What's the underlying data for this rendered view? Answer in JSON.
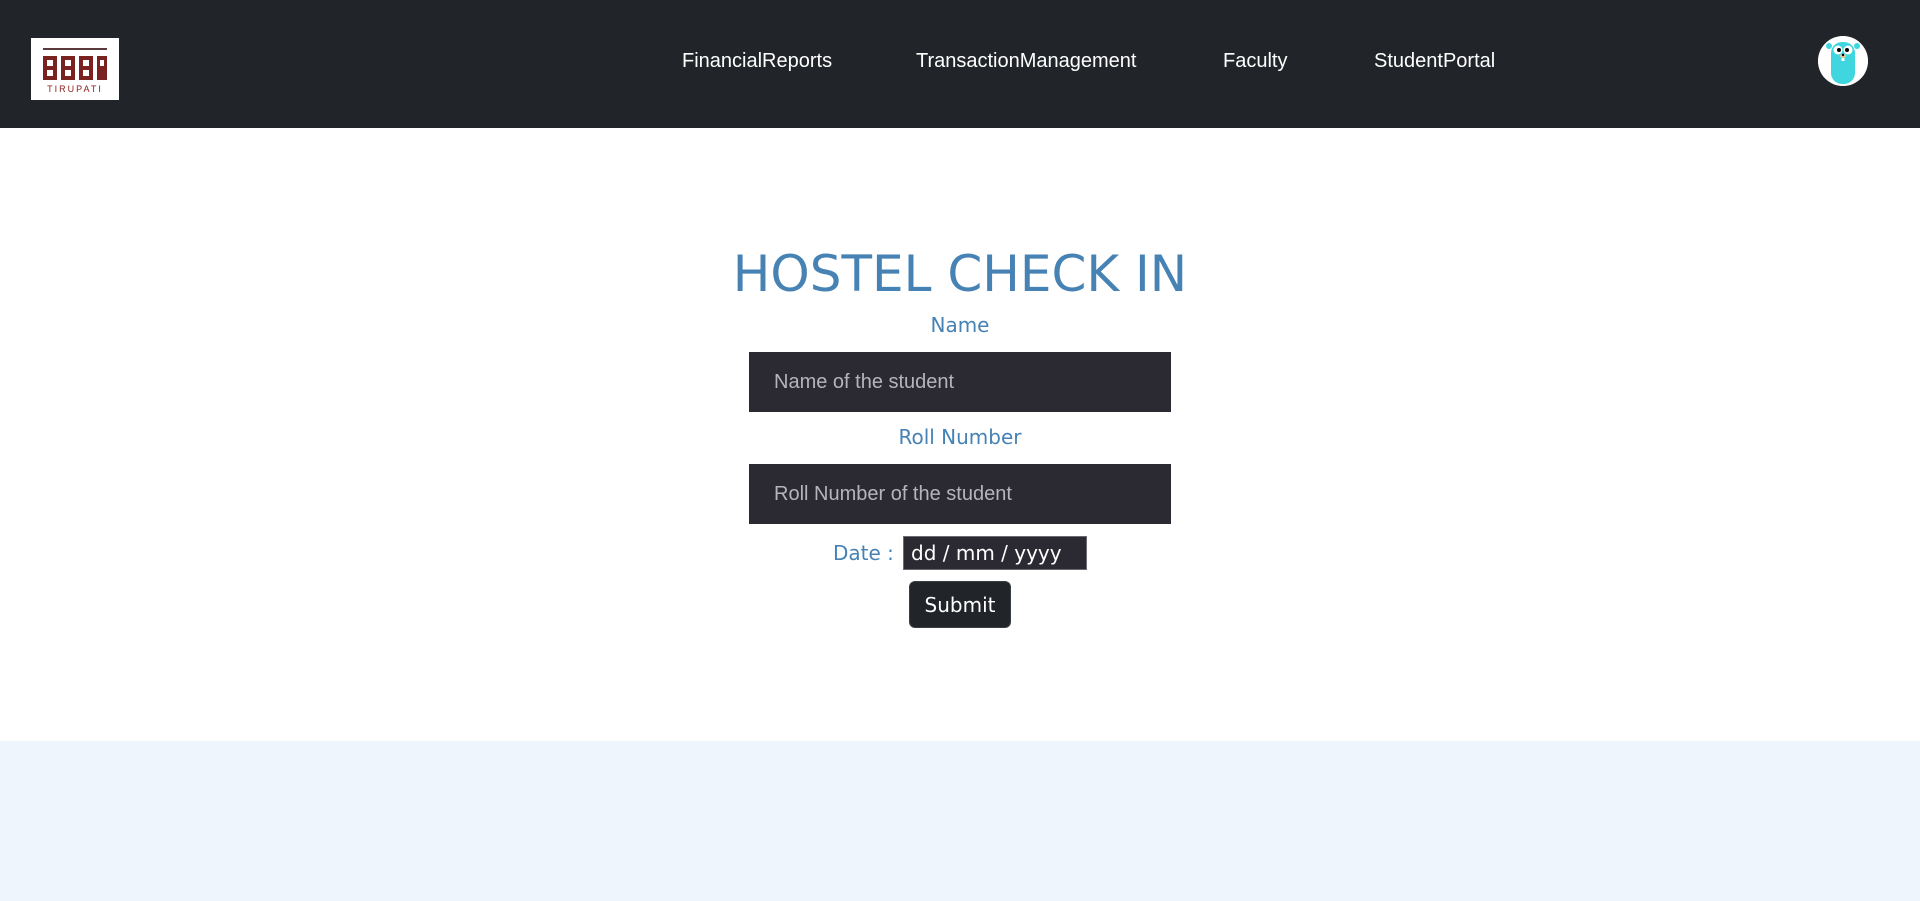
{
  "navbar": {
    "logo": {
      "alt_text_visible": "TIRUPATI"
    },
    "links": [
      {
        "label": "FinancialReports"
      },
      {
        "label": "TransactionManagement"
      },
      {
        "label": "Faculty"
      },
      {
        "label": "StudentPortal"
      }
    ],
    "avatar_icon": "gopher-avatar-icon"
  },
  "form": {
    "title": "HOSTEL CHECK IN",
    "name": {
      "label": "Name",
      "placeholder": "Name of the student",
      "value": ""
    },
    "roll": {
      "label": "Roll Number",
      "placeholder": "Roll Number of the student",
      "value": ""
    },
    "date": {
      "label": "Date :",
      "placeholder": "dd / mm / yyyy"
    },
    "submit_label": "Submit"
  },
  "colors": {
    "navbar": "#212529",
    "accent_text": "#4682b4",
    "input_bg": "#2b2a33",
    "footer_bg": "#eef5fd"
  }
}
